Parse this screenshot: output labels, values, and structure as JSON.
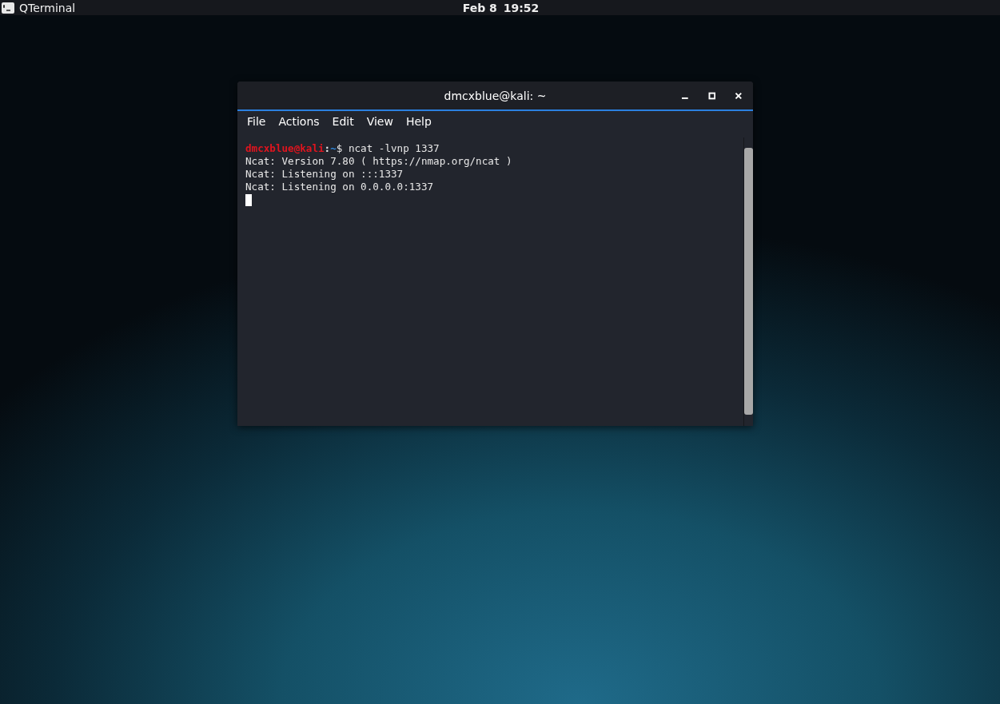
{
  "top_bar": {
    "app_name": "QTerminal",
    "date": "Feb 8",
    "time": "19:52"
  },
  "window": {
    "title": "dmcxblue@kali: ~",
    "menu": [
      "File",
      "Actions",
      "Edit",
      "View",
      "Help"
    ],
    "terminal": {
      "lines": [
        {
          "segments": [
            {
              "text": "dmcxblue@kali",
              "color": "#e0141e"
            },
            {
              "text": ":",
              "color": "#e8e8e8"
            },
            {
              "text": "~",
              "color": "#2f8ee6"
            },
            {
              "text": "$ ncat -lvnp 1337",
              "color": "#e8e8e8"
            }
          ]
        },
        {
          "segments": [
            {
              "text": "Ncat: Version 7.80 ( https://nmap.org/ncat )",
              "color": "#e8e8e8"
            }
          ]
        },
        {
          "segments": [
            {
              "text": "Ncat: Listening on :::1337",
              "color": "#e8e8e8"
            }
          ]
        },
        {
          "segments": [
            {
              "text": "Ncat: Listening on 0.0.0.0:1337",
              "color": "#e8e8e8"
            }
          ]
        }
      ],
      "cursor": true
    }
  }
}
